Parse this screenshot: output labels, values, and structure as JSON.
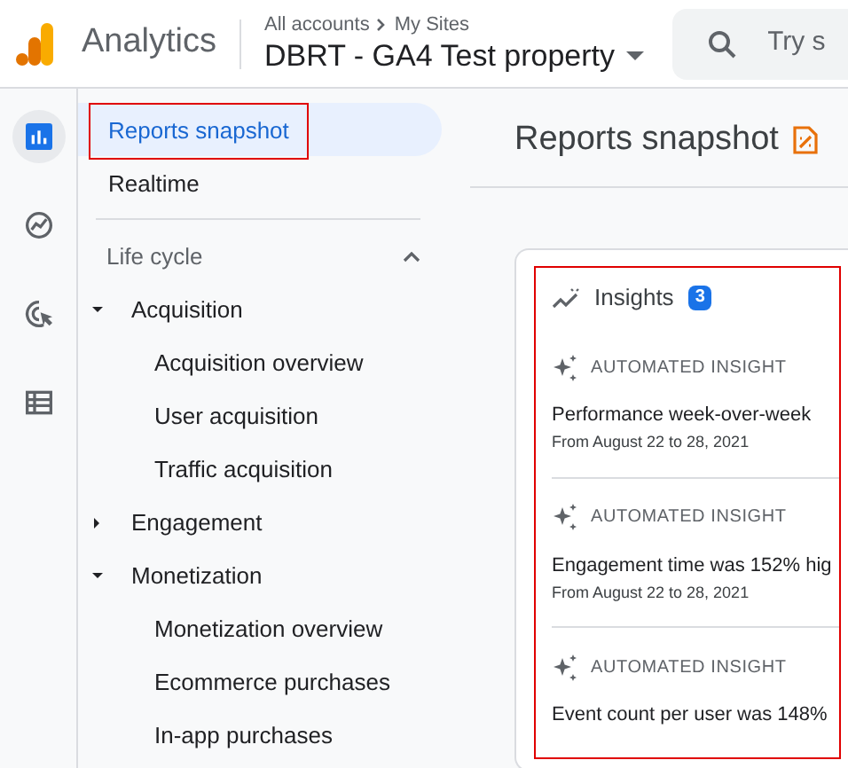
{
  "header": {
    "app_name": "Analytics",
    "breadcrumb": [
      "All accounts",
      "My Sites"
    ],
    "property": "DBRT - GA4 Test property",
    "search": {
      "placeholder": "Try s"
    }
  },
  "rail": [
    {
      "selected": true
    },
    {
      "selected": false
    },
    {
      "selected": false
    },
    {
      "selected": false
    }
  ],
  "nav": {
    "items": [
      {
        "label": "Reports snapshot",
        "selected": true,
        "highlighted": true
      },
      {
        "label": "Realtime",
        "selected": false,
        "highlighted": false
      }
    ],
    "section": {
      "label": "Life cycle",
      "expanded": true,
      "groups": [
        {
          "label": "Acquisition",
          "expanded": true,
          "children": [
            {
              "label": "Acquisition overview"
            },
            {
              "label": "User acquisition"
            },
            {
              "label": "Traffic acquisition"
            }
          ]
        },
        {
          "label": "Engagement",
          "expanded": false
        },
        {
          "label": "Monetization",
          "expanded": true,
          "children": [
            {
              "label": "Monetization overview"
            },
            {
              "label": "Ecommerce purchases"
            },
            {
              "label": "In-app purchases"
            }
          ]
        }
      ]
    }
  },
  "page_title": "Reports snapshot",
  "insights": {
    "title": "Insights",
    "count": "3",
    "highlighted": true,
    "items": [
      {
        "tag": "AUTOMATED INSIGHT",
        "headline": "Performance week-over-week",
        "date": "From August 22 to 28, 2021"
      },
      {
        "tag": "AUTOMATED INSIGHT",
        "headline": "Engagement time was 152% hig",
        "date": "From August 22 to 28, 2021"
      },
      {
        "tag": "AUTOMATED INSIGHT",
        "headline": "Event count per user was 148%"
      }
    ]
  }
}
